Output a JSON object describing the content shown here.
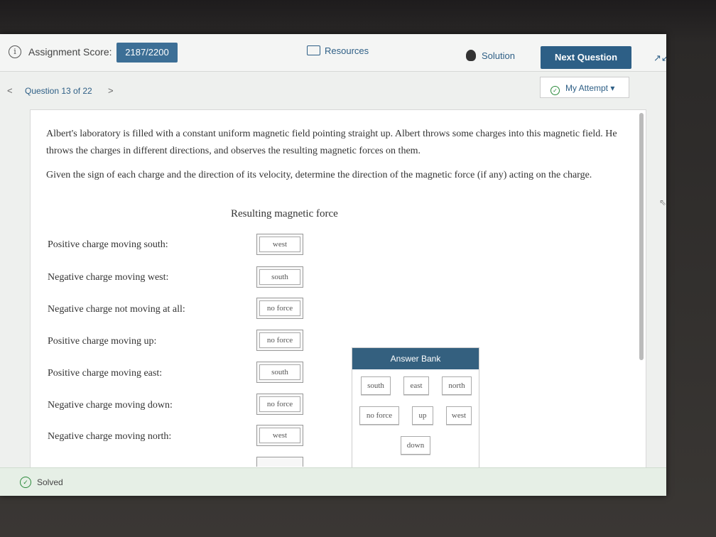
{
  "header": {
    "score_label": "Assignment Score:",
    "score_value": "2187/2200",
    "resources_label": "Resources",
    "solution_label": "Solution",
    "next_question_label": "Next Question"
  },
  "nav": {
    "question_label": "Question 13 of 22",
    "attempt_label": "My Attempt ▾"
  },
  "question": {
    "paragraph1": "Albert's laboratory is filled with a constant uniform magnetic field pointing straight up. Albert throws some charges into this magnetic field. He throws the charges in different directions, and observes the resulting magnetic forces on them.",
    "paragraph2": "Given the sign of each charge and the direction of its velocity, determine the direction of the magnetic force (if any) acting on the charge.",
    "column_header": "Resulting magnetic force"
  },
  "rows": [
    {
      "label": "Positive charge moving south:",
      "answer": "west"
    },
    {
      "label": "Negative charge moving west:",
      "answer": "south"
    },
    {
      "label": "Negative charge not moving at all:",
      "answer": "no force"
    },
    {
      "label": "Positive charge moving up:",
      "answer": "no force"
    },
    {
      "label": "Positive charge moving east:",
      "answer": "south"
    },
    {
      "label": "Negative charge moving down:",
      "answer": "no force"
    },
    {
      "label": "Negative charge moving north:",
      "answer": "west"
    }
  ],
  "answer_bank": {
    "title": "Answer Bank",
    "items": [
      "south",
      "east",
      "north",
      "no force",
      "up",
      "west",
      "down"
    ]
  },
  "status": {
    "solved_label": "Solved"
  }
}
